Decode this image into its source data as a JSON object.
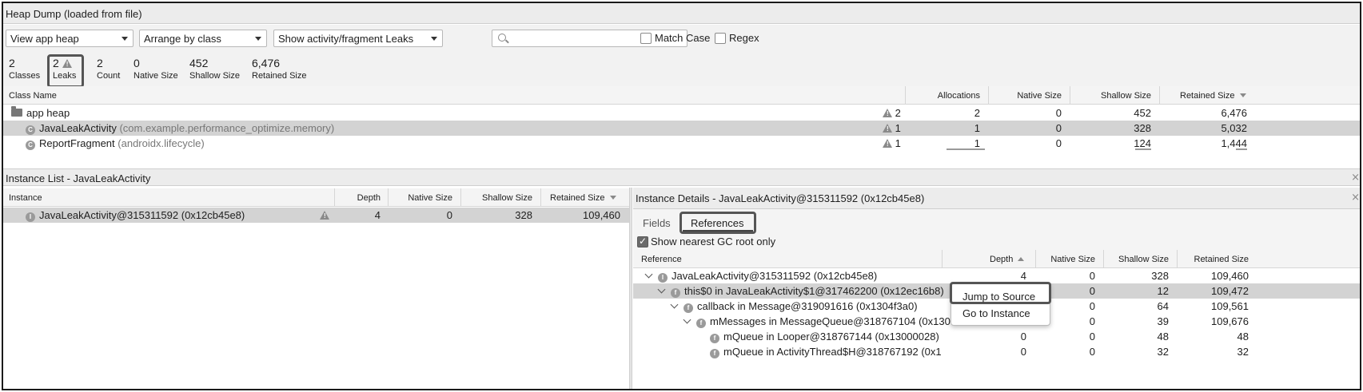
{
  "title": "Heap Dump (loaded from file)",
  "toolbar": {
    "heap_select": "View app heap",
    "arrange_select": "Arrange by class",
    "filter_select": "Show activity/fragment Leaks",
    "search_placeholder": "",
    "match_case_label": "Match Case",
    "regex_label": "Regex"
  },
  "stats": [
    {
      "value": "2",
      "label": "Classes"
    },
    {
      "value": "2",
      "label": "Leaks"
    },
    {
      "value": "2",
      "label": "Count"
    },
    {
      "value": "0",
      "label": "Native Size"
    },
    {
      "value": "452",
      "label": "Shallow Size"
    },
    {
      "value": "6,476",
      "label": "Retained Size"
    }
  ],
  "class_table": {
    "headers": {
      "name": "Class Name",
      "allocations": "Allocations",
      "native": "Native Size",
      "shallow": "Shallow Size",
      "retained": "Retained Size"
    },
    "rows": [
      {
        "name": "app heap",
        "pkg": "",
        "leaks": "2",
        "allocations": "2",
        "native": "0",
        "shallow": "452",
        "retained": "6,476"
      },
      {
        "name": "JavaLeakActivity",
        "pkg": "(com.example.performance_optimize.memory)",
        "leaks": "1",
        "allocations": "1",
        "native": "0",
        "shallow": "328",
        "retained": "5,032"
      },
      {
        "name": "ReportFragment",
        "pkg": "(androidx.lifecycle)",
        "leaks": "1",
        "allocations": "1",
        "native": "0",
        "shallow": "124",
        "retained": "1,444"
      }
    ]
  },
  "instance_list": {
    "title": "Instance List - JavaLeakActivity",
    "headers": {
      "instance": "Instance",
      "depth": "Depth",
      "native": "Native Size",
      "shallow": "Shallow Size",
      "retained": "Retained Size"
    },
    "rows": [
      {
        "name": "JavaLeakActivity@315311592 (0x12cb45e8)",
        "depth": "4",
        "native": "0",
        "shallow": "328",
        "retained": "109,460"
      }
    ]
  },
  "instance_details": {
    "title": "Instance Details - JavaLeakActivity@315311592 (0x12cb45e8)",
    "tab_fields": "Fields",
    "tab_references": "References",
    "gc_root_label": "Show nearest GC root only",
    "headers": {
      "reference": "Reference",
      "depth": "Depth",
      "native": "Native Size",
      "shallow": "Shallow Size",
      "retained": "Retained Size"
    },
    "rows": [
      {
        "name": "JavaLeakActivity@315311592 (0x12cb45e8)",
        "badge": "I",
        "depth": "4",
        "native": "0",
        "shallow": "328",
        "retained": "109,460"
      },
      {
        "name": "this$0 in JavaLeakActivity$1@317462200 (0x12ec16b8)",
        "badge": "f",
        "depth": "",
        "native": "0",
        "shallow": "12",
        "retained": "109,472"
      },
      {
        "name": "callback in Message@319091616 (0x1304f3a0)",
        "badge": "f",
        "depth": "",
        "native": "0",
        "shallow": "64",
        "retained": "109,561"
      },
      {
        "name": "mMessages in MessageQueue@318767104 (0x130",
        "badge": "f",
        "depth": "",
        "native": "0",
        "shallow": "39",
        "retained": "109,676"
      },
      {
        "name": "mQueue in Looper@318767144 (0x13000028)",
        "badge": "f",
        "depth": "0",
        "native": "0",
        "shallow": "48",
        "retained": "48"
      },
      {
        "name": "mQueue in ActivityThread$H@318767192 (0x130",
        "badge": "f",
        "depth": "0",
        "native": "0",
        "shallow": "32",
        "retained": "32"
      }
    ]
  },
  "context_menu": {
    "jump": "Jump to Source",
    "goto": "Go to Instance"
  },
  "close_glyph": "×"
}
